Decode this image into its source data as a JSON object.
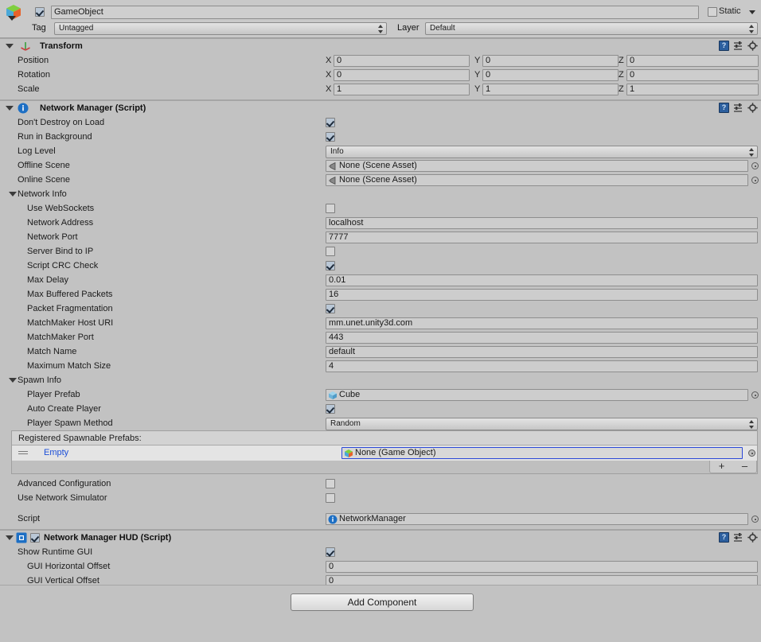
{
  "gameobject": {
    "name_value": "GameObject",
    "enabled": true,
    "static_label": "Static",
    "static_checked": false,
    "tag_label": "Tag",
    "tag_value": "Untagged",
    "layer_label": "Layer",
    "layer_value": "Default",
    "icon": "unity-cube-icon"
  },
  "transform": {
    "title": "Transform",
    "icon": "transform-axis-icon",
    "rows": [
      {
        "label": "Position",
        "x": "0",
        "y": "0",
        "z": "0"
      },
      {
        "label": "Rotation",
        "x": "0",
        "y": "0",
        "z": "0"
      },
      {
        "label": "Scale",
        "x": "1",
        "y": "1",
        "z": "1"
      }
    ],
    "axis": {
      "x": "X",
      "y": "Y",
      "z": "Z"
    }
  },
  "network_manager": {
    "title": "Network Manager (Script)",
    "icon": "info-script-icon",
    "dont_destroy_on_load": {
      "label": "Don't Destroy on Load",
      "checked": true
    },
    "run_in_background": {
      "label": "Run in Background",
      "checked": true
    },
    "log_level": {
      "label": "Log Level",
      "value": "Info"
    },
    "offline_scene": {
      "label": "Offline Scene",
      "value": "None (Scene Asset)",
      "icon": "scene-asset-icon"
    },
    "online_scene": {
      "label": "Online Scene",
      "value": "None (Scene Asset)",
      "icon": "scene-asset-icon"
    },
    "network_info": {
      "label": "Network Info",
      "fields": [
        {
          "label": "Use WebSockets",
          "type": "checkbox",
          "checked": false
        },
        {
          "label": "Network Address",
          "type": "text",
          "value": "localhost"
        },
        {
          "label": "Network Port",
          "type": "text",
          "value": "7777"
        },
        {
          "label": "Server Bind to IP",
          "type": "checkbox",
          "checked": false
        },
        {
          "label": "Script CRC Check",
          "type": "checkbox",
          "checked": true
        },
        {
          "label": "Max Delay",
          "type": "text",
          "value": "0.01"
        },
        {
          "label": "Max Buffered Packets",
          "type": "text",
          "value": "16"
        },
        {
          "label": "Packet Fragmentation",
          "type": "checkbox",
          "checked": true
        },
        {
          "label": "MatchMaker Host URI",
          "type": "text",
          "value": "mm.unet.unity3d.com"
        },
        {
          "label": "MatchMaker Port",
          "type": "text",
          "value": "443"
        },
        {
          "label": "Match Name",
          "type": "text",
          "value": "default"
        },
        {
          "label": "Maximum Match Size",
          "type": "text",
          "value": "4"
        }
      ]
    },
    "spawn_info": {
      "label": "Spawn Info",
      "player_prefab": {
        "label": "Player Prefab",
        "value": "Cube",
        "icon": "prefab-cube-icon"
      },
      "auto_create_player": {
        "label": "Auto Create Player",
        "checked": true
      },
      "player_spawn_method": {
        "label": "Player Spawn Method",
        "value": "Random"
      },
      "registered_prefabs": {
        "header": "Registered Spawnable Prefabs:",
        "rows": [
          {
            "label": "Empty",
            "value": "None (Game Object)",
            "icon": "gameobject-prefab-icon"
          }
        ],
        "add_label": "+",
        "remove_label": "–"
      }
    },
    "advanced_configuration": {
      "label": "Advanced Configuration",
      "checked": false
    },
    "use_network_simulator": {
      "label": "Use Network Simulator",
      "checked": false
    },
    "script": {
      "label": "Script",
      "value": "NetworkManager",
      "icon": "cs-script-icon"
    }
  },
  "network_manager_hud": {
    "title": "Network Manager HUD (Script)",
    "icon": "script-square-icon",
    "enabled": true,
    "show_runtime_gui": {
      "label": "Show Runtime GUI",
      "checked": true
    },
    "gui_horizontal_offset": {
      "label": "GUI Horizontal Offset",
      "value": "0"
    },
    "gui_vertical_offset": {
      "label": "GUI Vertical Offset",
      "value": "0"
    }
  },
  "footer": {
    "add_component_label": "Add Component"
  },
  "header_icons": {
    "help": "help-book-icon",
    "preset": "preset-sliders-icon",
    "settings": "gear-icon"
  },
  "colors": {
    "background": "#c2c2c2",
    "panel": "#c9c9c9",
    "field": "#cdcdcd",
    "link": "#1b4ed8",
    "selection_border": "#2b48d8",
    "info_blue": "#2c5f9e"
  }
}
